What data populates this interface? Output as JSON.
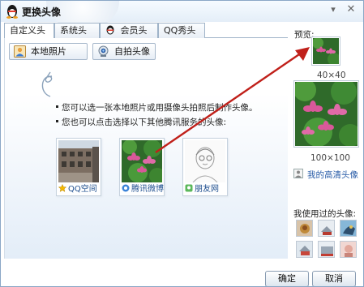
{
  "window": {
    "title": "更换头像"
  },
  "tabs": [
    {
      "label": "自定义头像",
      "active": true
    },
    {
      "label": "系统头像",
      "active": false
    },
    {
      "label": "会员头像",
      "active": false,
      "icon": "qq-penguin-icon"
    },
    {
      "label": "QQ秀头像",
      "active": false
    }
  ],
  "toolbar": {
    "local_photo": "本地照片",
    "self_shot": "自拍头像"
  },
  "hints": [
    "您可以选一张本地照片或用摄像头拍照后制作头像。",
    "您也可以点击选择以下其他腾讯服务的头像:"
  ],
  "services": [
    {
      "label": "QQ空间",
      "icon": "star-icon"
    },
    {
      "label": "腾讯微博",
      "icon": "weibo-icon"
    },
    {
      "label": "朋友网",
      "icon": "pengyou-icon"
    }
  ],
  "preview": {
    "label": "预览:",
    "small_size": "40×40",
    "large_size": "100×100",
    "hd_link": "我的高清头像"
  },
  "history": {
    "label": "我使用过的头像:"
  },
  "buttons": {
    "ok": "确定",
    "cancel": "取消"
  },
  "colors": {
    "accent_arrow": "#c0201a",
    "link": "#2a5da8",
    "border": "#8aa7c6"
  }
}
